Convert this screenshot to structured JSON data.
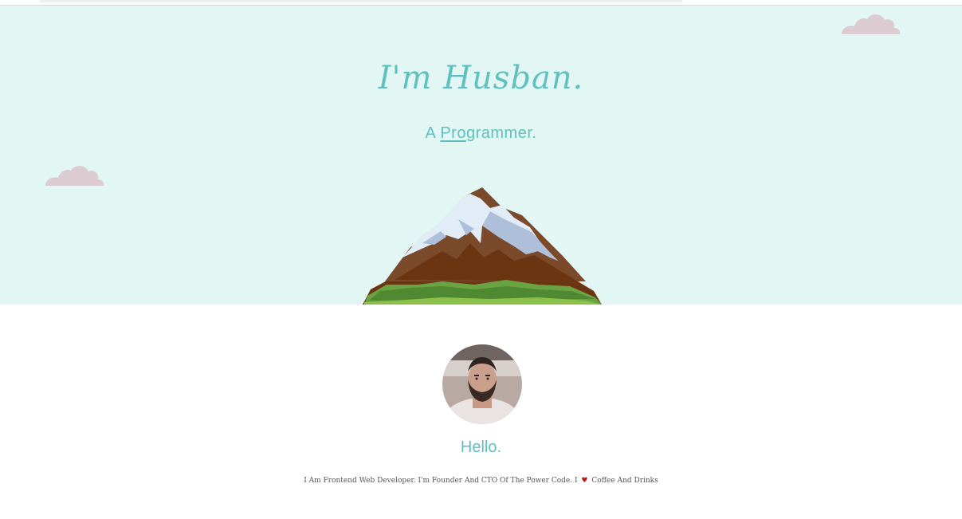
{
  "hero": {
    "title": "I'm Husban.",
    "subtitle_prefix": "A ",
    "subtitle_typed": "Pro",
    "subtitle_rest": "grammer."
  },
  "about": {
    "greeting": "Hello.",
    "bio_before": "I Am Frontend Web Developer. I'm Founder And CTO Of The Power Code. I",
    "heart_symbol": "♥",
    "bio_after": "Coffee And Drinks"
  },
  "colors": {
    "hero_background": "#e2f6f4",
    "accent": "#5fc0bf",
    "cloud": "#dcccd2",
    "heart": "#c0141c"
  },
  "icons": {
    "cloud": "cloud-icon",
    "mountain": "mountain-illustration",
    "heart": "heart-icon"
  }
}
